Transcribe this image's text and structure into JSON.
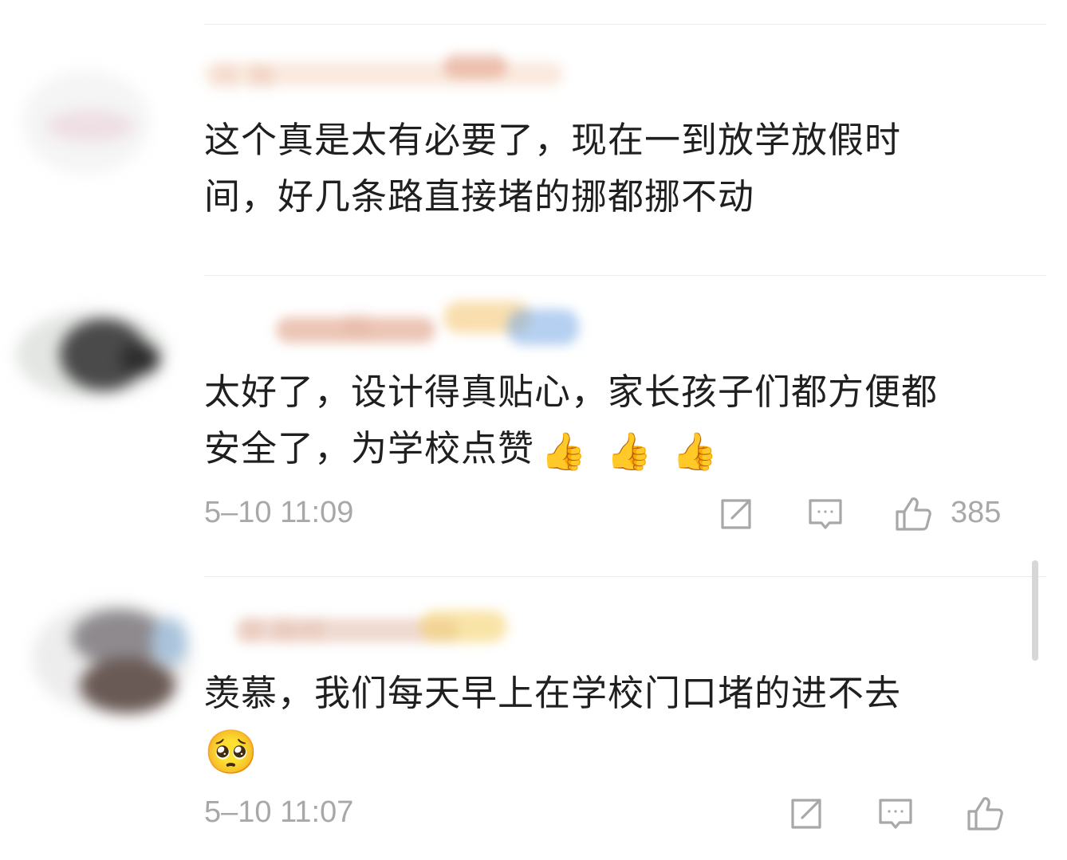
{
  "comments": [
    {
      "name_blurred": "月 舞",
      "text_lines": [
        "这个真是太有必要了，现在一到放学放假时",
        "间，好几条路直接堵的挪都挪不动"
      ]
    },
    {
      "name_blurred": "阳",
      "text_lines": [
        "太好了，设计得真贴心，家长孩子们都方便都",
        "安全了，为学校点赞"
      ],
      "emojis": [
        "👍",
        "👍",
        "👍"
      ],
      "time": "5–10 11:09",
      "like_count": "385"
    },
    {
      "name_blurred": "游 路修",
      "text_lines": [
        "羡慕，我们每天早上在学校门口堵的进不去"
      ],
      "emoji_line": "🥺",
      "time": "5–10 11:07"
    }
  ],
  "icons": {
    "share": "share-icon",
    "comment": "comment-icon",
    "like": "thumbs-up-icon"
  },
  "colors": {
    "text": "#1f1f1f",
    "meta": "#a8a8a8",
    "divider": "#ececec"
  }
}
